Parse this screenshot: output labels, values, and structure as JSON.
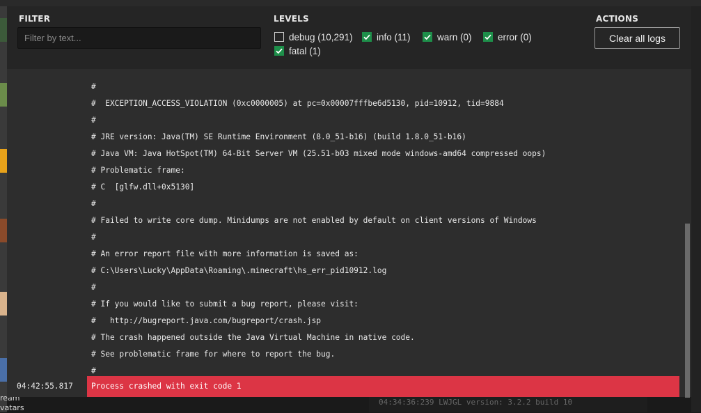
{
  "header": {
    "filter_title": "FILTER",
    "filter_placeholder": "Filter by text...",
    "filter_value": "",
    "levels_title": "LEVELS",
    "actions_title": "ACTIONS",
    "clear_label": "Clear all logs"
  },
  "levels": [
    {
      "label": "debug (10,291)",
      "checked": false
    },
    {
      "label": "info (11)",
      "checked": true
    },
    {
      "label": "warn (0)",
      "checked": true
    },
    {
      "label": "error (0)",
      "checked": true
    },
    {
      "label": "fatal (1)",
      "checked": true
    }
  ],
  "log_lines": [
    "#",
    "#  EXCEPTION_ACCESS_VIOLATION (0xc0000005) at pc=0x00007fffbe6d5130, pid=10912, tid=9884",
    "#",
    "# JRE version: Java(TM) SE Runtime Environment (8.0_51-b16) (build 1.8.0_51-b16)",
    "# Java VM: Java HotSpot(TM) 64-Bit Server VM (25.51-b03 mixed mode windows-amd64 compressed oops)",
    "# Problematic frame:",
    "# C  [glfw.dll+0x5130]",
    "#",
    "# Failed to write core dump. Minidumps are not enabled by default on client versions of Windows",
    "#",
    "# An error report file with more information is saved as:",
    "# C:\\Users\\Lucky\\AppData\\Roaming\\.minecraft\\hs_err_pid10912.log",
    "#",
    "# If you would like to submit a bug report, please visit:",
    "#   http://bugreport.java.com/bugreport/crash.jsp",
    "# The crash happened outside the Java Virtual Machine in native code.",
    "# See problematic frame for where to report the bug.",
    "#"
  ],
  "status": {
    "time": "04:42:55.817",
    "message": "Process crashed with exit code 1"
  },
  "background": {
    "left_text": [
      "ream",
      "vatars"
    ],
    "bottom_text": "04:34:36:239     LWJGL version: 3.2.2 build 10"
  },
  "colors": {
    "checkbox_on": "#1e8f4a",
    "error_bar": "#dc3545"
  }
}
